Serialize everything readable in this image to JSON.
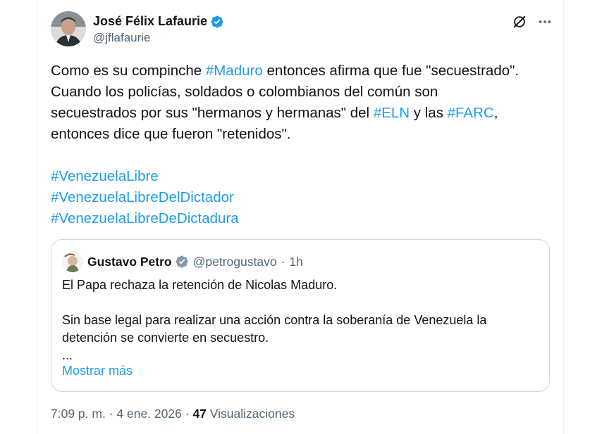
{
  "author": {
    "display_name": "José Félix Lafaurie",
    "handle": "@jflafaurie"
  },
  "icons": {
    "verified": "verified-badge-icon",
    "grok": "grok-icon",
    "more": "more-options-icon"
  },
  "tweet": {
    "lines": [
      [
        "Como es su compinche ",
        "#Maduro",
        " entonces afirma que fue \"secuestrado\"."
      ],
      [
        "Cuando los policías, soldados o colombianos del común son"
      ],
      [
        "secuestrados por sus \"hermanos y hermanas\" del ",
        "#ELN",
        " y las ",
        "#FARC",
        ","
      ],
      [
        "entonces dice que fueron \"retenidos\"."
      ]
    ],
    "hashtags": [
      "#VenezuelaLibre",
      "#VenezuelaLibreDelDictador",
      "#VenezuelaLibreDeDictadura"
    ]
  },
  "quote": {
    "display_name": "Gustavo Petro",
    "handle": "@petrogustavo",
    "separator": "·",
    "time": "1h",
    "paragraphs": [
      "El Papa rechaza la retención de Nicolas Maduro.",
      "",
      "Sin base legal para realizar una acción contra la soberanía de Venezuela la",
      "detención se convierte en secuestro.",
      "..."
    ],
    "show_more": "Mostrar más"
  },
  "meta": {
    "time": "7:09 p. m.",
    "sep1": "·",
    "date": "4 ene. 2026",
    "sep2": "·",
    "views_count": "47",
    "views_label": "Visualizaciones"
  },
  "colors": {
    "link": "#1d9bf0",
    "secondary": "#536471",
    "border": "#cfd9de",
    "verified": "#1d9bf0"
  }
}
